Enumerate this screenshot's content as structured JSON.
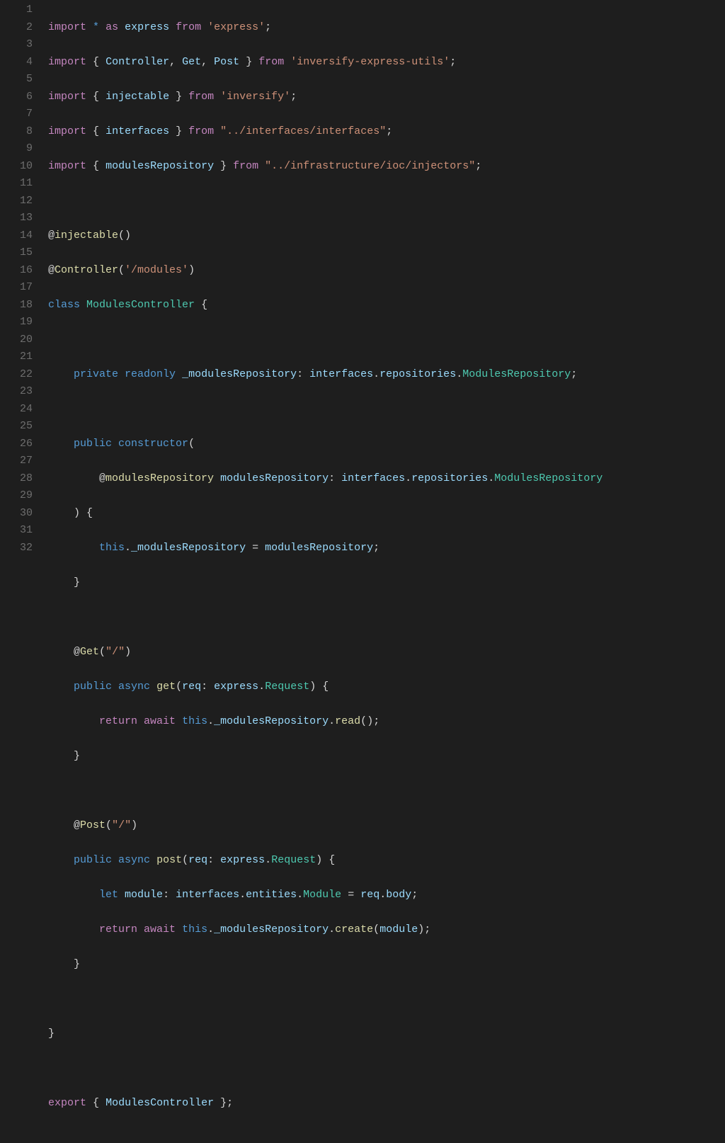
{
  "lines": [
    {
      "num": "1"
    },
    {
      "num": "2"
    },
    {
      "num": "3"
    },
    {
      "num": "4"
    },
    {
      "num": "5"
    },
    {
      "num": "6"
    },
    {
      "num": "7"
    },
    {
      "num": "8"
    },
    {
      "num": "9"
    },
    {
      "num": "10"
    },
    {
      "num": "11"
    },
    {
      "num": "12"
    },
    {
      "num": "13"
    },
    {
      "num": "14"
    },
    {
      "num": "15"
    },
    {
      "num": "16"
    },
    {
      "num": "17"
    },
    {
      "num": "18"
    },
    {
      "num": "19"
    },
    {
      "num": "20"
    },
    {
      "num": "21"
    },
    {
      "num": "22"
    },
    {
      "num": "23"
    },
    {
      "num": "24"
    },
    {
      "num": "25"
    },
    {
      "num": "26"
    },
    {
      "num": "27"
    },
    {
      "num": "28"
    },
    {
      "num": "29"
    },
    {
      "num": "30"
    },
    {
      "num": "31"
    },
    {
      "num": "32"
    }
  ],
  "tokens": {
    "import": "import",
    "export": "export",
    "from": "from",
    "as": "as",
    "star": "*",
    "class": "class",
    "public": "public",
    "private": "private",
    "readonly": "readonly",
    "async": "async",
    "return": "return",
    "await": "await",
    "let": "let",
    "this": "this",
    "constructor": "constructor",
    "express": "express",
    "Controller": "Controller",
    "Get": "Get",
    "Post": "Post",
    "injectable": "injectable",
    "interfaces": "interfaces",
    "modulesRepository": "modulesRepository",
    "ModulesController": "ModulesController",
    "_modulesRepository": "_modulesRepository",
    "repositories": "repositories",
    "ModulesRepository": "ModulesRepository",
    "entities": "entities",
    "Module": "Module",
    "req": "req",
    "Request": "Request",
    "body": "body",
    "module": "module",
    "get": "get",
    "post": "post",
    "read": "read",
    "create": "create",
    "str_express": "'express'",
    "str_inversify_utils": "'inversify-express-utils'",
    "str_inversify": "'inversify'",
    "str_interfaces": "\"../interfaces/interfaces\"",
    "str_injectors": "\"../infrastructure/ioc/injectors\"",
    "str_modules": "'/modules'",
    "str_slash": "\"/\"",
    "lbrace": "{",
    "rbrace": "}",
    "lparen": "(",
    "rparen": ")",
    "semi": ";",
    "colon": ":",
    "comma": ",",
    "dot": ".",
    "eq": "=",
    "at": "@"
  }
}
